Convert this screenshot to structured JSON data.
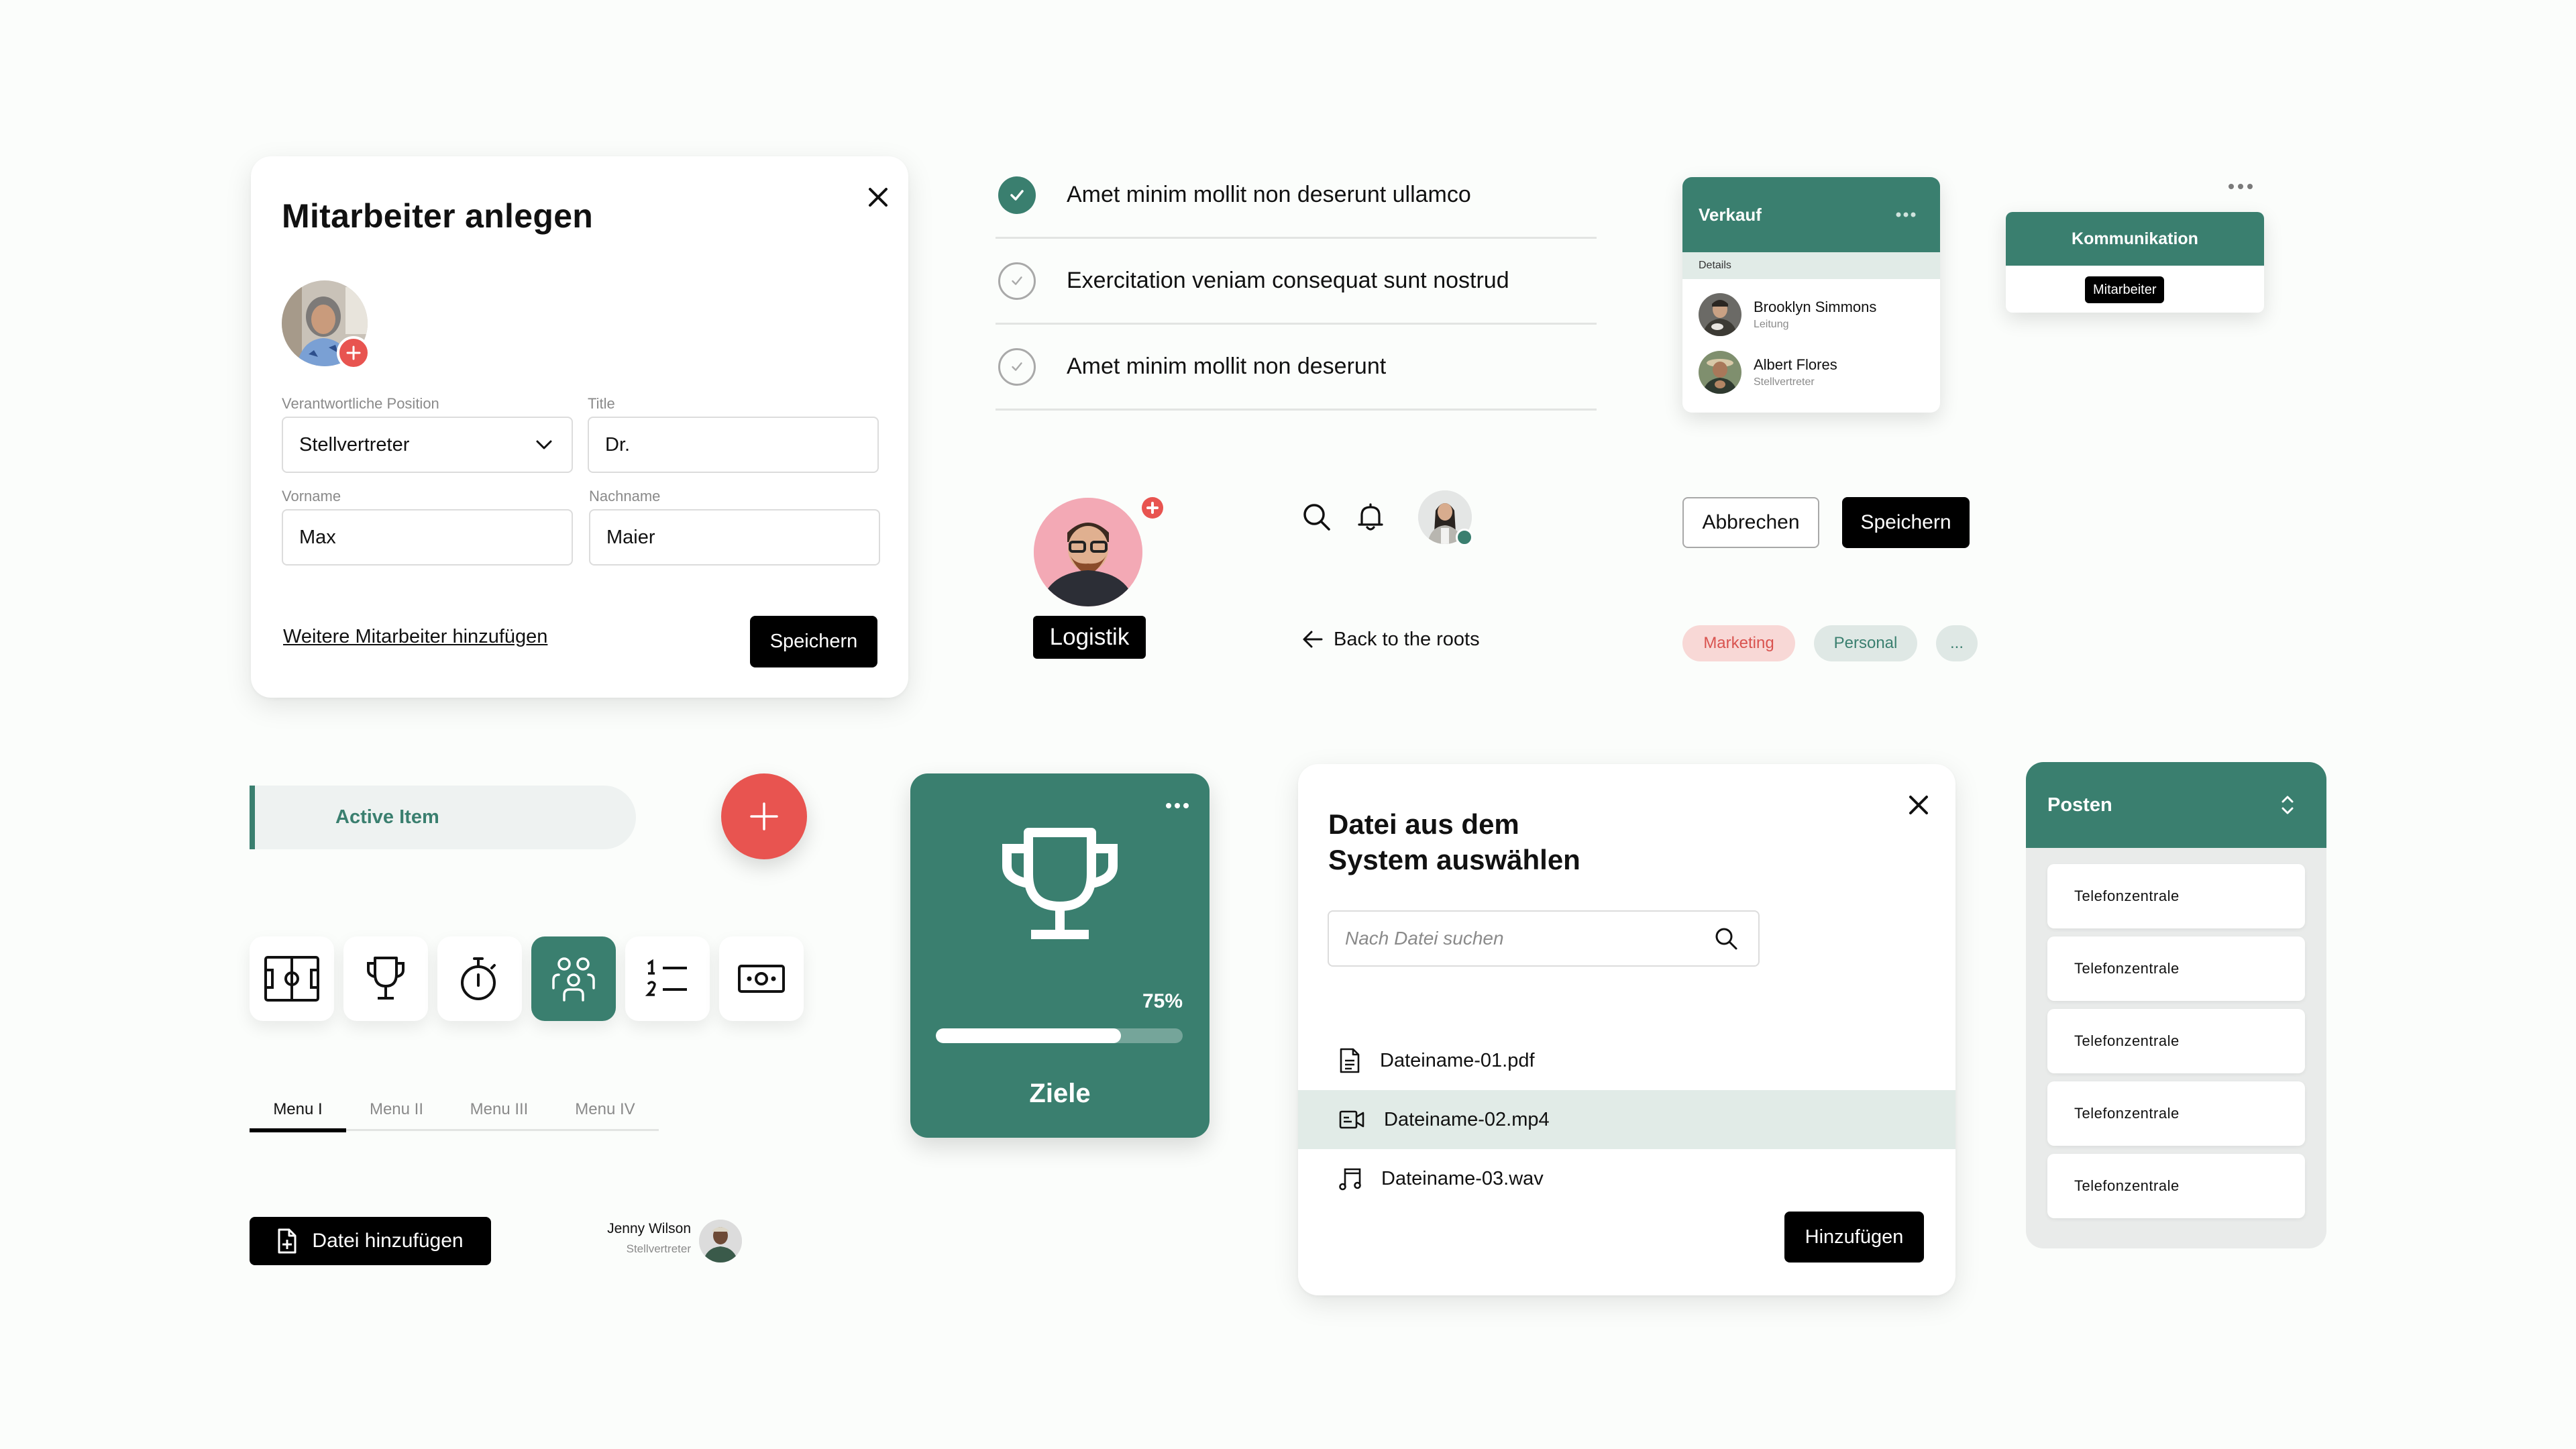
{
  "colors": {
    "accent": "#3a7f6f",
    "danger": "#e85450",
    "background": "#fbfdfb",
    "selected_row": "#e1ebe7"
  },
  "employee_form": {
    "title": "Mitarbeiter anlegen",
    "close_icon": "close-icon",
    "add_photo_icon": "plus-icon",
    "fields": {
      "position": {
        "label": "Verantwortliche Position",
        "value": "Stellvertreter"
      },
      "title": {
        "label": "Title",
        "value": "Dr."
      },
      "first_name": {
        "label": "Vorname",
        "value": "Max"
      },
      "last_name": {
        "label": "Nachname",
        "value": "Maier"
      }
    },
    "add_more_link": "Weitere Mitarbeiter hinzufügen",
    "save_label": "Speichern"
  },
  "checklist": [
    {
      "text": "Amet minim mollit non deserunt ullamco",
      "checked": true
    },
    {
      "text": "Exercitation veniam consequat sunt nostrud",
      "checked": false
    },
    {
      "text": "Amet minim mollit non deserunt",
      "checked": false
    }
  ],
  "department_card": {
    "title": "Verkauf",
    "menu_icon": "more-horizontal-icon",
    "section_label": "Details",
    "people": [
      {
        "name": "Brooklyn Simmons",
        "role": "Leitung"
      },
      {
        "name": "Albert Flores",
        "role": "Stellvertreter"
      }
    ]
  },
  "communication_card": {
    "title": "Kommunikation",
    "badge": "Mitarbeiter",
    "menu_icon": "more-horizontal-icon"
  },
  "logistics": {
    "label": "Logistik",
    "add_icon": "plus-icon"
  },
  "topbar": {
    "search_icon": "search-icon",
    "bell_icon": "bell-icon",
    "online_status": "online"
  },
  "back_link": "Back to the roots",
  "buttons": {
    "cancel": "Abbrechen",
    "save": "Speichern"
  },
  "tags": [
    {
      "label": "Marketing",
      "color": "#d9534f"
    },
    {
      "label": "Personal",
      "color": "#3a7f6f"
    },
    {
      "label": "..."
    }
  ],
  "active_item": {
    "label": "Active Item"
  },
  "fab": {
    "icon": "plus-icon"
  },
  "icon_bar": [
    {
      "icon": "soccer-field-icon",
      "active": false
    },
    {
      "icon": "trophy-icon",
      "active": false
    },
    {
      "icon": "stopwatch-icon",
      "active": false
    },
    {
      "icon": "team-icon",
      "active": true
    },
    {
      "icon": "numbered-list-icon",
      "active": false
    },
    {
      "icon": "money-bill-icon",
      "active": false
    }
  ],
  "tabs": [
    {
      "label": "Menu I",
      "active": true
    },
    {
      "label": "Menu II",
      "active": false
    },
    {
      "label": "Menu III",
      "active": false
    },
    {
      "label": "Menu IV",
      "active": false
    }
  ],
  "add_file_button": {
    "label": "Datei hinzufügen",
    "icon": "file-plus-icon"
  },
  "user_chip": {
    "name": "Jenny Wilson",
    "role": "Stellvertreter"
  },
  "goals_card": {
    "label": "Ziele",
    "progress_percent": 75,
    "progress_text": "75%",
    "icon": "trophy-icon"
  },
  "file_dialog": {
    "title_line1": "Datei aus dem",
    "title_line2": "System auswählen",
    "search_placeholder": "Nach Datei suchen",
    "search_value": "",
    "files": [
      {
        "name": "Dateiname-01.pdf",
        "icon": "document-icon",
        "selected": false
      },
      {
        "name": "Dateiname-02.mp4",
        "icon": "video-icon",
        "selected": true
      },
      {
        "name": "Dateiname-03.wav",
        "icon": "music-icon",
        "selected": false
      }
    ],
    "add_label": "Hinzufügen"
  },
  "posts_card": {
    "title": "Posten",
    "sort_icon": "chevron-up-down-icon",
    "items": [
      "Telefonzentrale",
      "Telefonzentrale",
      "Telefonzentrale",
      "Telefonzentrale",
      "Telefonzentrale"
    ]
  }
}
